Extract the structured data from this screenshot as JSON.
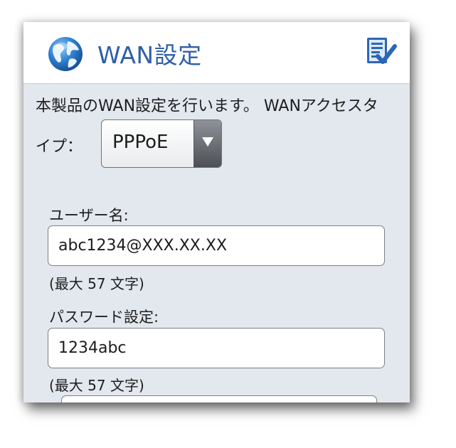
{
  "header": {
    "title": "WAN設定",
    "globe_icon": "globe-icon",
    "apply_icon": "checklist-icon",
    "title_color": "#2f5fa8"
  },
  "description": "本製品のWAN設定を行います。 WANアクセスタ",
  "access_type": {
    "label": "イプ：",
    "selected": "PPPoE"
  },
  "username": {
    "label": "ユーザー名:",
    "value": "abc1234@XXX.XX.XX",
    "hint": "(最大 57 文字)"
  },
  "password": {
    "label": "パスワード設定:",
    "value": "1234abc",
    "hint": "(最大 57 文字)"
  }
}
